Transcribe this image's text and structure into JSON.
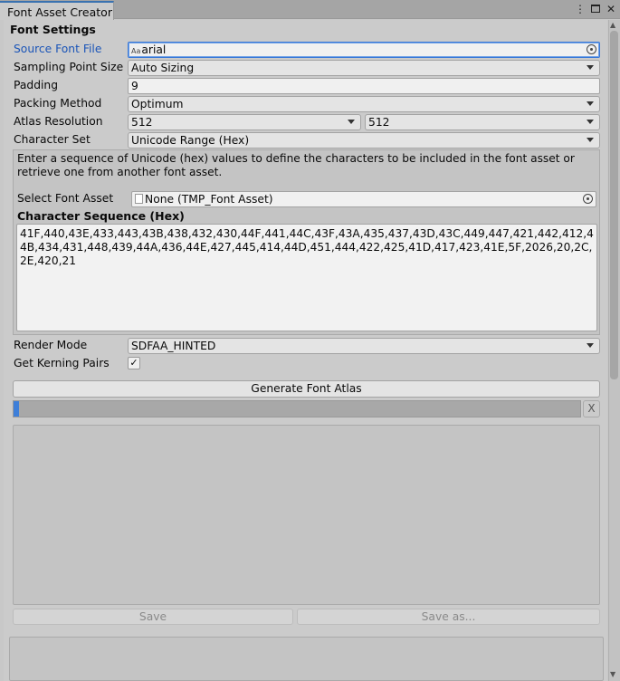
{
  "window": {
    "tab_title": "Font Asset Creator",
    "menu_icon": "kebab-menu-icon",
    "maximize_icon": "maximize-icon",
    "close_icon": "close-icon",
    "close_glyph": "✕"
  },
  "font_settings": {
    "section_title": "Font Settings",
    "source_font_label": "Source Font File",
    "source_font_value": "arial",
    "source_font_icon_text": "Aa",
    "sampling_label": "Sampling Point Size",
    "sampling_value": "Auto Sizing",
    "padding_label": "Padding",
    "padding_value": "9",
    "packing_label": "Packing Method",
    "packing_value": "Optimum",
    "atlas_label": "Atlas Resolution",
    "atlas_width": "512",
    "atlas_height": "512",
    "charset_label": "Character Set",
    "charset_value": "Unicode Range (Hex)"
  },
  "charset_box": {
    "help_text": "Enter a sequence of Unicode (hex) values to define the characters to be included in the font asset or retrieve one from another font asset.",
    "select_font_asset_label": "Select Font Asset",
    "select_font_asset_value": "None (TMP_Font Asset)",
    "sequence_title": "Character Sequence (Hex)",
    "sequence_value": "41F,440,43E,433,443,43B,438,432,430,44F,441,44C,43F,43A,435,437,43D,43C,449,447,421,442,412,44B,434,431,448,439,44A,436,44E,427,445,414,44D,451,444,422,425,41D,417,423,41E,5F,2026,20,2C,2E,420,21"
  },
  "render": {
    "render_mode_label": "Render Mode",
    "render_mode_value": "SDFAA_HINTED",
    "kerning_label": "Get Kerning Pairs",
    "kerning_checked": true,
    "checkmark": "✓"
  },
  "actions": {
    "generate_label": "Generate Font Atlas",
    "progress": 0.01,
    "progress_cancel_label": "X",
    "save_label": "Save",
    "save_as_label": "Save as..."
  },
  "colors": {
    "accent": "#3e7fd9",
    "label_highlight": "#1b55b8"
  }
}
